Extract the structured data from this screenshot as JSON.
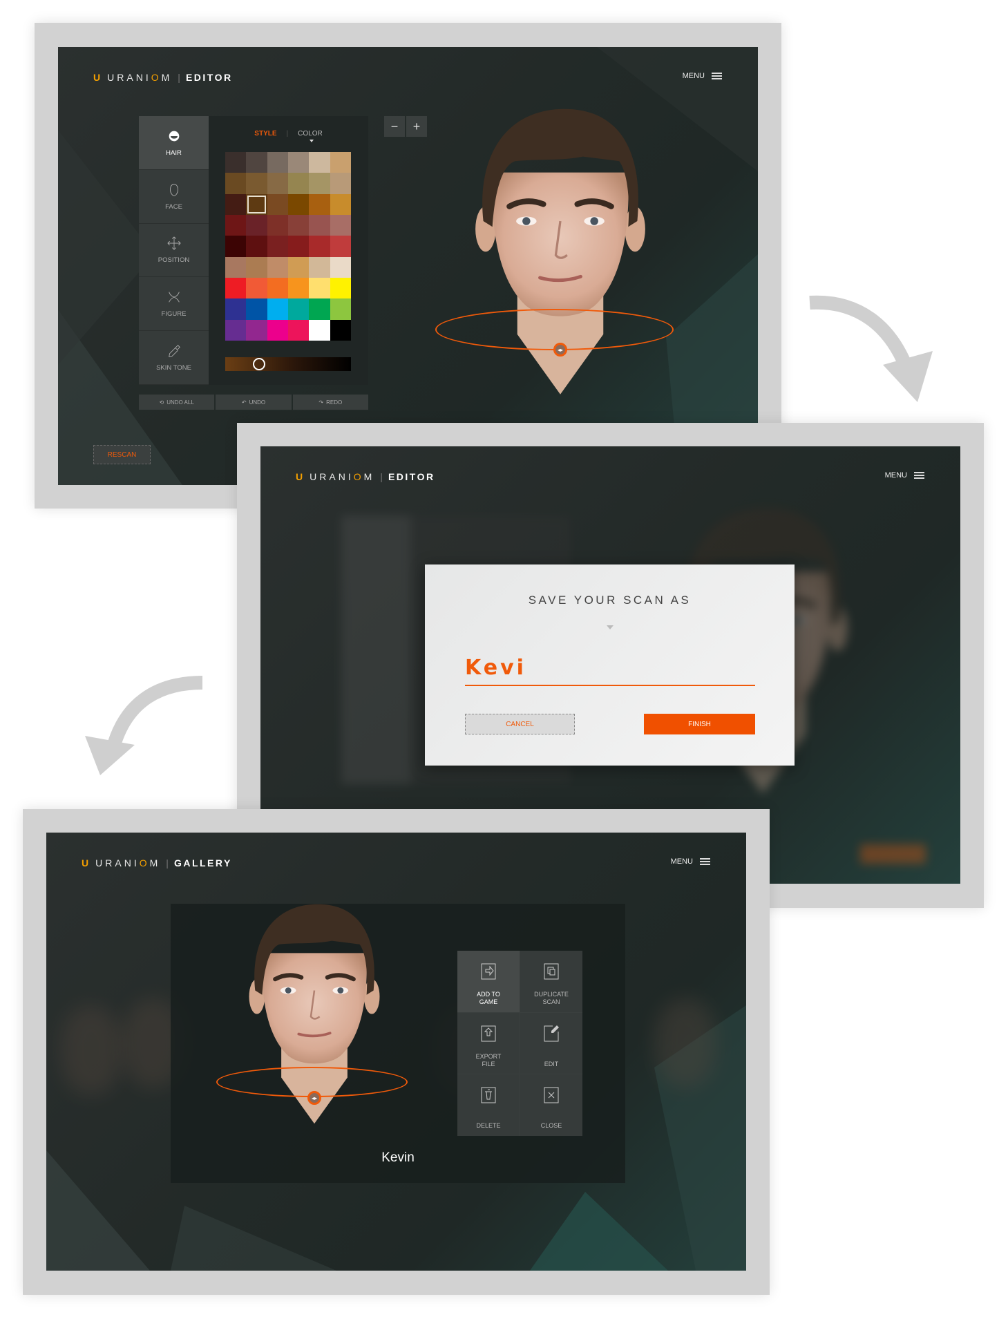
{
  "brand": {
    "name": "URANIOM",
    "accent": "#f05a0a",
    "logo_color": "#f5a000"
  },
  "editor": {
    "section": "EDITOR",
    "menu_label": "MENU",
    "sidebar": [
      {
        "label": "HAIR",
        "icon": "hair-icon",
        "active": true
      },
      {
        "label": "FACE",
        "icon": "face-icon"
      },
      {
        "label": "POSITION",
        "icon": "position-icon"
      },
      {
        "label": "FIGURE",
        "icon": "figure-icon"
      },
      {
        "label": "SKIN TONE",
        "icon": "eyedropper-icon"
      }
    ],
    "tabs": {
      "style": "STYLE",
      "color": "COLOR",
      "active": "STYLE"
    },
    "swatches": [
      "#3a2f2c",
      "#504540",
      "#776a60",
      "#9a8878",
      "#cdb89e",
      "#c9a06e",
      "#6a4a22",
      "#7a5a30",
      "#876a45",
      "#958550",
      "#a59565",
      "#b89a78",
      "#441c14",
      "#5e3a12",
      "#7a4a22",
      "#7a4800",
      "#a86010",
      "#c88c2c",
      "#6e1616",
      "#6a2228",
      "#7e3028",
      "#884038",
      "#985450",
      "#a86e66",
      "#3c0404",
      "#5e1010",
      "#7a2020",
      "#861c1c",
      "#a82a2a",
      "#c03c3c",
      "#a87860",
      "#ab7c52",
      "#c08c68",
      "#d09c54",
      "#d2b898",
      "#eadac8",
      "#ee1c24",
      "#f15a36",
      "#f36d21",
      "#f7941d",
      "#ffdf6e",
      "#fff200",
      "#2e3192",
      "#0054a6",
      "#00aeef",
      "#00a99d",
      "#00a651",
      "#8dc63f",
      "#662d91",
      "#92278f",
      "#ec008c",
      "#ed145b",
      "#ffffff",
      "#000000"
    ],
    "selected_swatch": 13,
    "shade_slider": 0.27,
    "undo_all": "UNDO ALL",
    "undo": "UNDO",
    "redo": "REDO",
    "zoom_out": "−",
    "zoom_in": "+",
    "rescan": "RESCAN"
  },
  "save_dialog": {
    "section": "EDITOR",
    "menu_label": "MENU",
    "title": "SAVE YOUR SCAN AS",
    "input_value": "Kevi",
    "cancel": "CANCEL",
    "finish": "FINISH"
  },
  "gallery": {
    "section": "GALLERY",
    "menu_label": "MENU",
    "scan_name": "Kevin",
    "actions": [
      {
        "label": "ADD TO\nGAME",
        "icon": "add-to-game-icon",
        "highlight": true
      },
      {
        "label": "DUPLICATE\nSCAN",
        "icon": "duplicate-icon"
      },
      {
        "label": "EXPORT\nFILE",
        "icon": "export-icon"
      },
      {
        "label": "EDIT",
        "icon": "edit-icon"
      },
      {
        "label": "DELETE",
        "icon": "trash-icon"
      },
      {
        "label": "CLOSE",
        "icon": "close-icon"
      }
    ]
  }
}
